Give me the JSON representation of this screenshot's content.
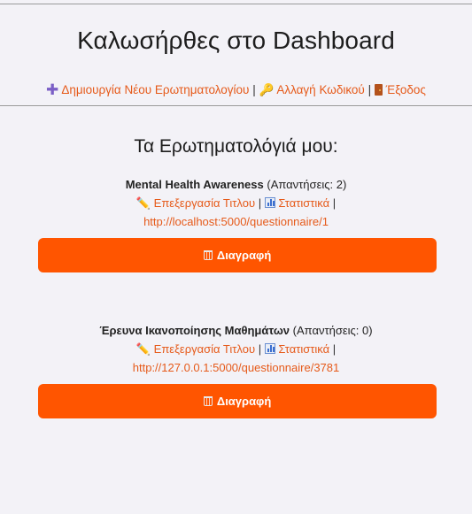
{
  "header": {
    "title": "Καλωσήρθες στο Dashboard"
  },
  "nav": {
    "items": [
      {
        "label": "Δημιουργία Νέου Ερωτηματολογίου",
        "icon": "plus-icon"
      },
      {
        "label": "Αλλαγή Κωδικού",
        "icon": "key-icon"
      },
      {
        "label": "Έξοδος",
        "icon": "door-icon"
      }
    ],
    "separator": "|"
  },
  "section": {
    "title": "Τα Ερωτηματολόγιά μου:"
  },
  "questionnaires": [
    {
      "title": "Mental Health Awareness",
      "responses": "(Απαντήσεις: 2)",
      "edit_label": "Επεξεργασία Τιτλου",
      "stats_label": "Στατιστικά",
      "link": "http://localhost:5000/questionnaire/1",
      "delete_label": "Διαγραφή"
    },
    {
      "title": "Έρευνα Ικανοποίησης Μαθημάτων",
      "responses": "(Απαντήσεις: 0)",
      "edit_label": "Επεξεργασία Τιτλου",
      "stats_label": "Στατιστικά",
      "link": "http://127.0.0.1:5000/questionnaire/3781",
      "delete_label": "Διαγραφή"
    }
  ],
  "colors": {
    "accent": "#ff5500",
    "link": "#e65a1a",
    "background": "#f3f2f7"
  }
}
